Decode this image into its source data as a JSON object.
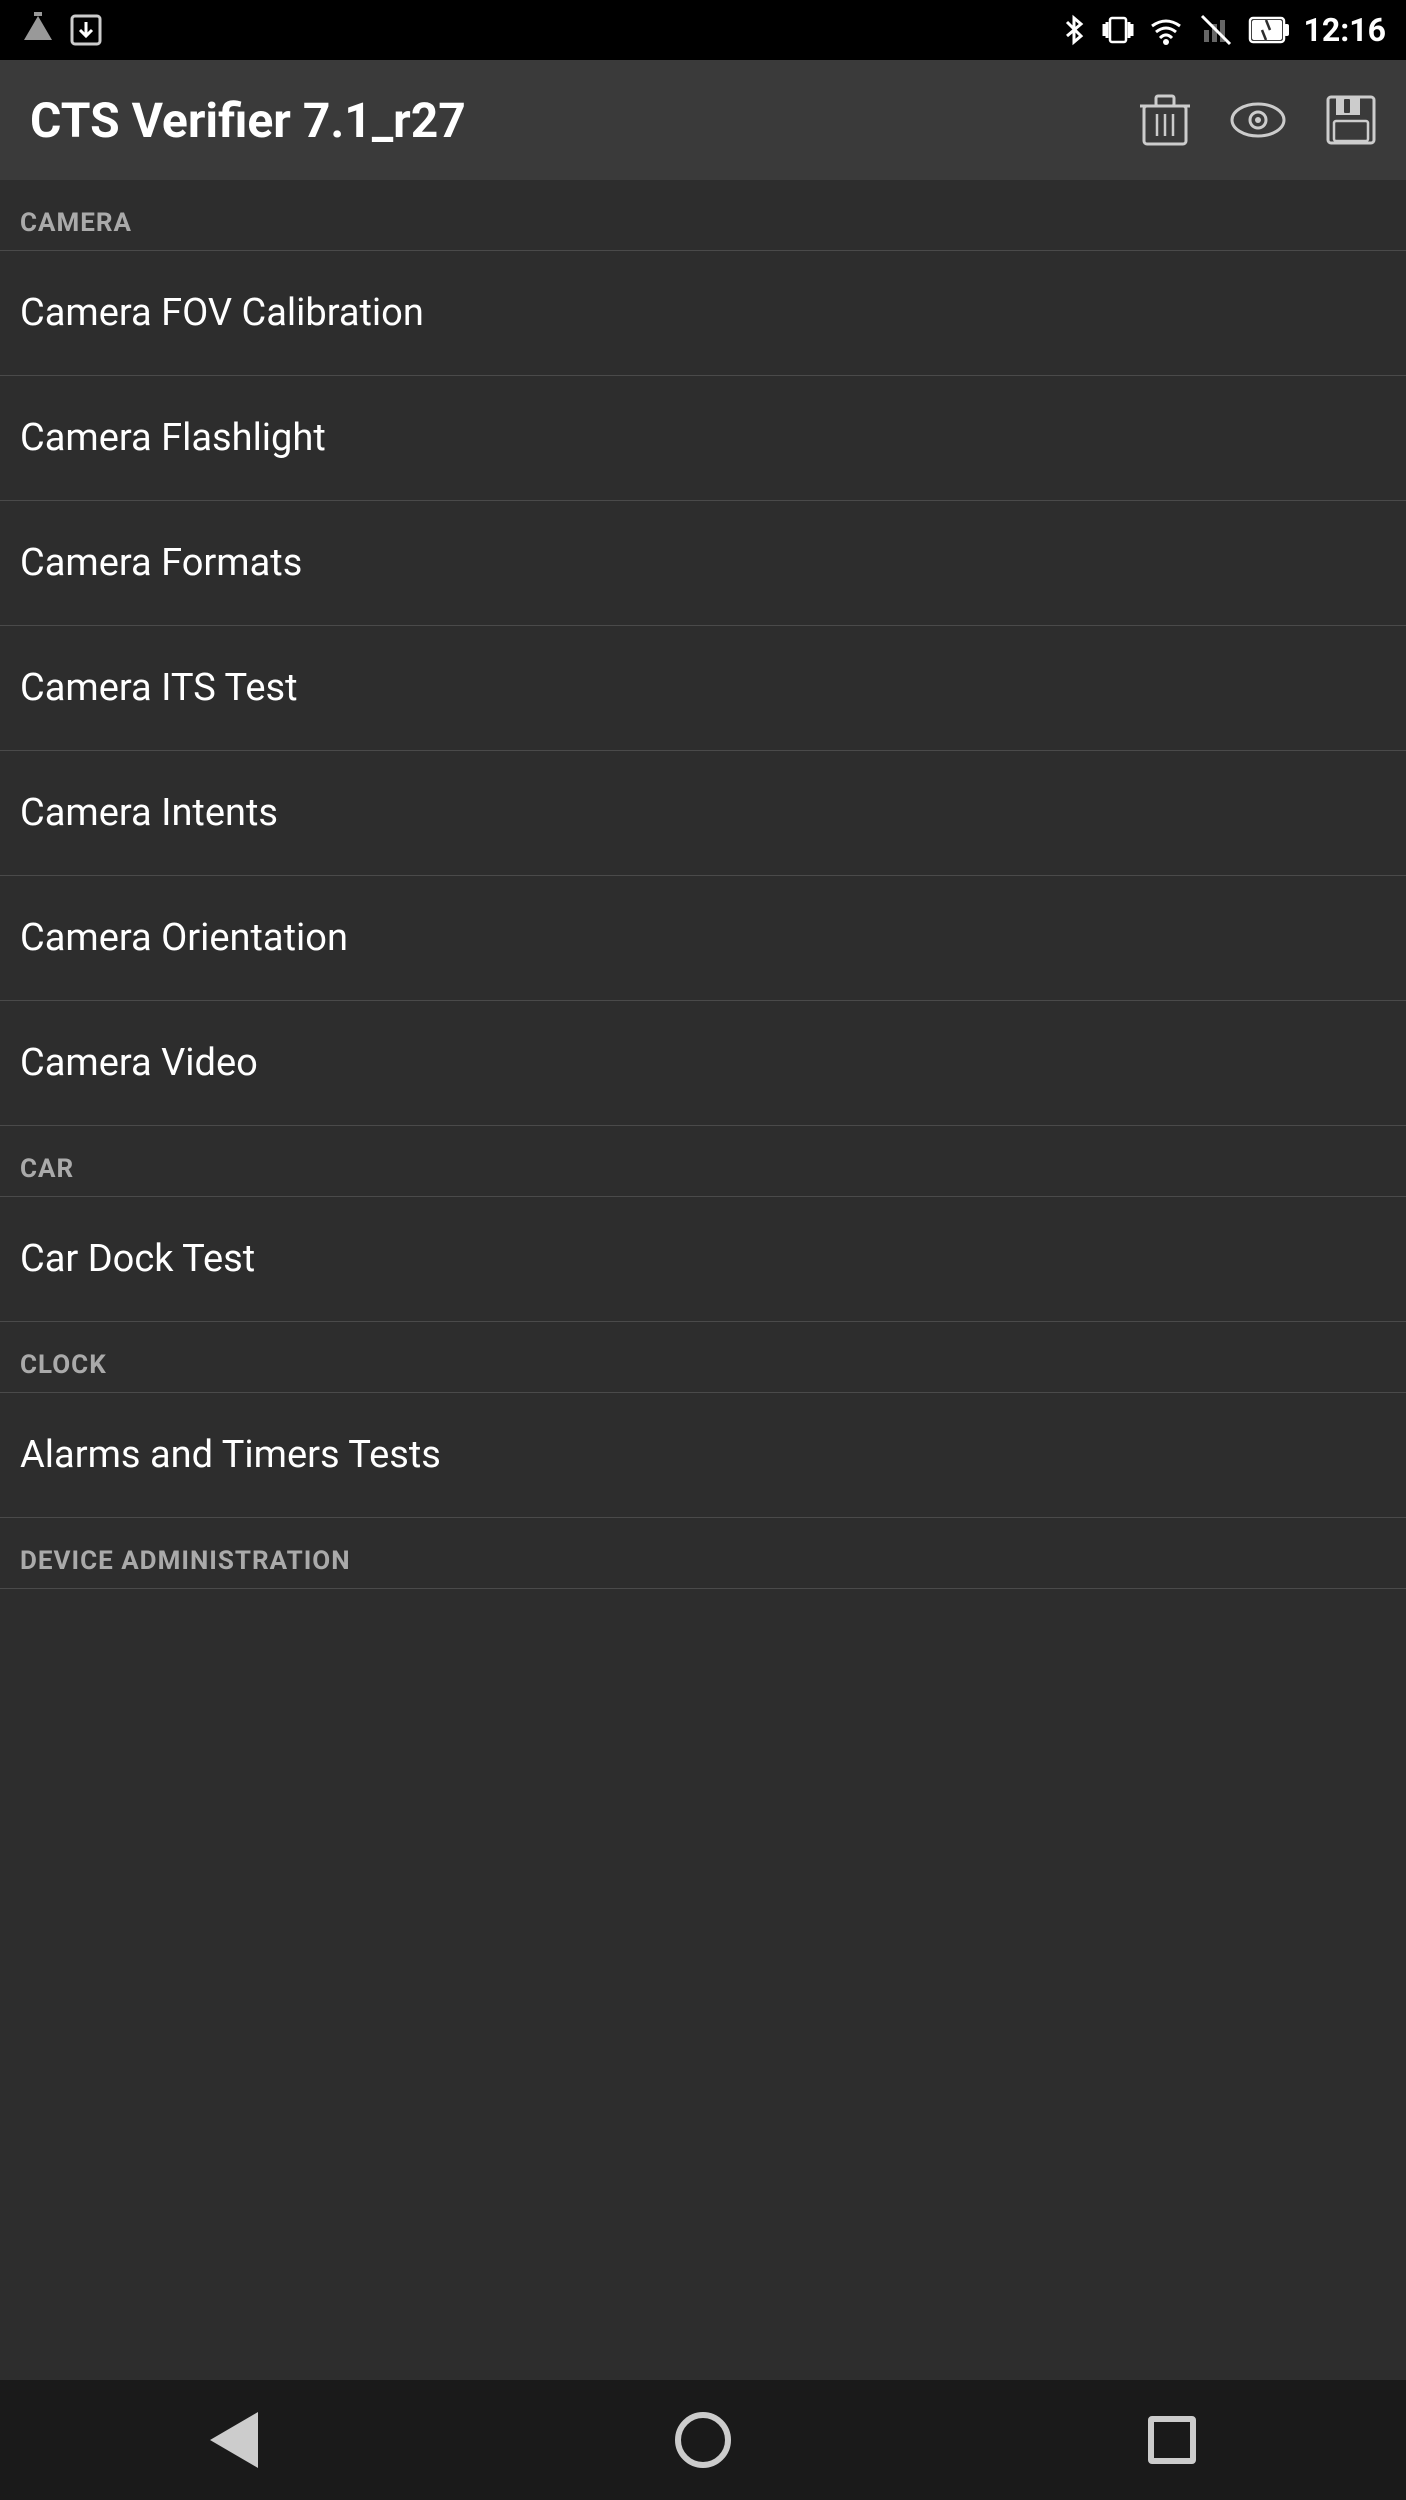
{
  "statusBar": {
    "time": "12:16",
    "icons": [
      "bluetooth",
      "vibrate",
      "wifi",
      "signal",
      "battery"
    ]
  },
  "appBar": {
    "title": "CTS Verifier 7.1_r27",
    "actions": {
      "trash_label": "trash",
      "eye_label": "eye",
      "save_label": "save"
    }
  },
  "sections": [
    {
      "id": "camera",
      "header": "CAMERA",
      "items": [
        "Camera FOV Calibration",
        "Camera Flashlight",
        "Camera Formats",
        "Camera ITS Test",
        "Camera Intents",
        "Camera Orientation",
        "Camera Video"
      ]
    },
    {
      "id": "car",
      "header": "CAR",
      "items": [
        "Car Dock Test"
      ]
    },
    {
      "id": "clock",
      "header": "CLOCK",
      "items": [
        "Alarms and Timers Tests"
      ]
    },
    {
      "id": "device-administration",
      "header": "DEVICE ADMINISTRATION",
      "items": []
    }
  ],
  "navBar": {
    "back_label": "back",
    "home_label": "home",
    "recents_label": "recents"
  }
}
